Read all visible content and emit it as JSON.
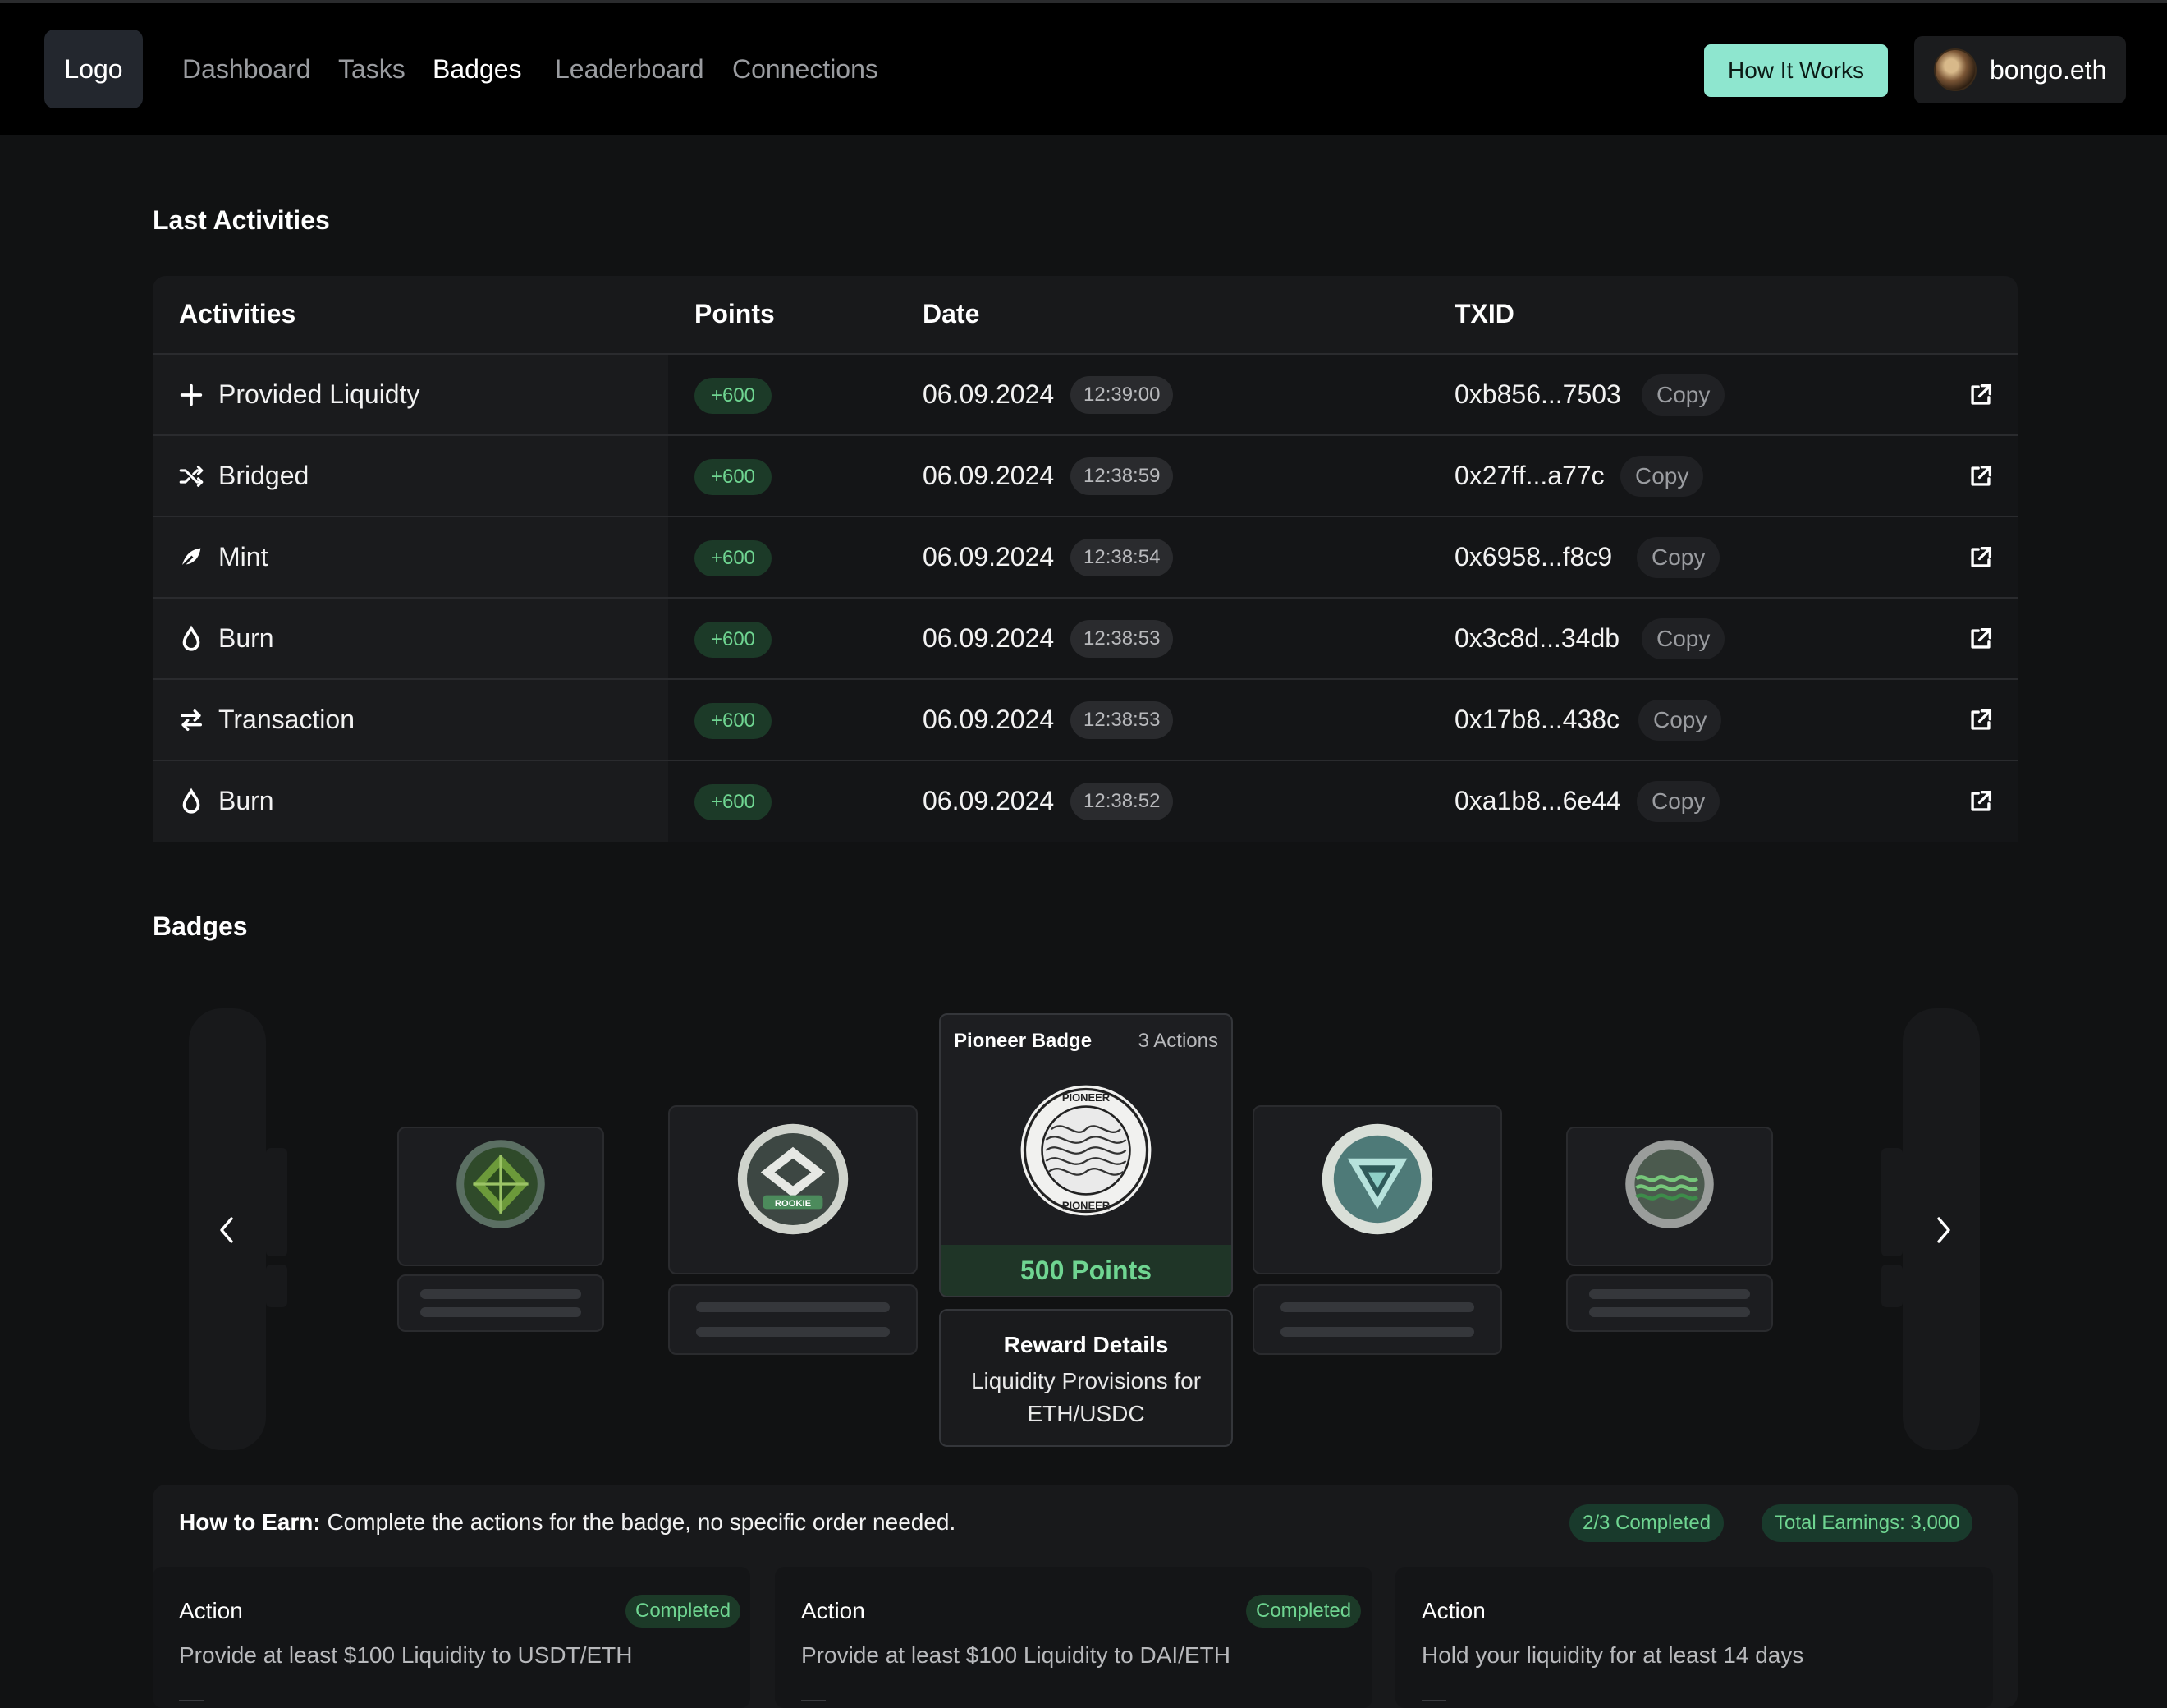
{
  "nav": {
    "logo": "Logo",
    "links": [
      "Dashboard",
      "Tasks",
      "Badges",
      "Leaderboard",
      "Connections"
    ],
    "active": "Badges",
    "how_it_works": "How It Works",
    "user": "bongo.eth"
  },
  "activities": {
    "title": "Last Activities",
    "columns": [
      "Activities",
      "Points",
      "Date",
      "TXID"
    ],
    "copy_label": "Copy",
    "rows": [
      {
        "icon": "plus-icon",
        "label": "Provided Liquidty",
        "points": "+600",
        "date": "06.09.2024",
        "time": "12:39:00",
        "txid": "0xb856...7503"
      },
      {
        "icon": "shuffle-icon",
        "label": "Bridged",
        "points": "+600",
        "date": "06.09.2024",
        "time": "12:38:59",
        "txid": "0x27ff...a77c"
      },
      {
        "icon": "leaf-icon",
        "label": "Mint",
        "points": "+600",
        "date": "06.09.2024",
        "time": "12:38:54",
        "txid": "0x6958...f8c9"
      },
      {
        "icon": "drop-icon",
        "label": "Burn",
        "points": "+600",
        "date": "06.09.2024",
        "time": "12:38:53",
        "txid": "0x3c8d...34db"
      },
      {
        "icon": "swap-icon",
        "label": "Transaction",
        "points": "+600",
        "date": "06.09.2024",
        "time": "12:38:53",
        "txid": "0x17b8...438c"
      },
      {
        "icon": "drop-icon",
        "label": "Burn",
        "points": "+600",
        "date": "06.09.2024",
        "time": "12:38:52",
        "txid": "0xa1b8...6e44"
      }
    ]
  },
  "badges": {
    "title": "Badges",
    "featured": {
      "name": "Pioneer Badge",
      "actions": "3 Actions",
      "coin_text": "PIONEER",
      "points": "500 Points",
      "reward_title": "Reward Details",
      "reward_text": "Liquidity Provisions for ETH/USDC"
    },
    "coin_labels": {
      "rookie": "ROOKIE"
    }
  },
  "earn": {
    "label": "How to Earn:",
    "text": "Complete the actions for the badge, no specific order needed.",
    "completed": "2/3 Completed",
    "total": "Total Earnings: 3,000",
    "actions": [
      {
        "title": "Action",
        "status": "Completed",
        "desc": "Provide at least $100 Liquidity to USDT/ETH"
      },
      {
        "title": "Action",
        "status": "Completed",
        "desc": "Provide at least $100 Liquidity to DAI/ETH"
      },
      {
        "title": "Action",
        "status": "",
        "desc": "Hold your liquidity for at least 14 days"
      }
    ]
  },
  "colors": {
    "accent": "#8ee6cf",
    "points_green": "#6fd591",
    "background": "#111213"
  }
}
